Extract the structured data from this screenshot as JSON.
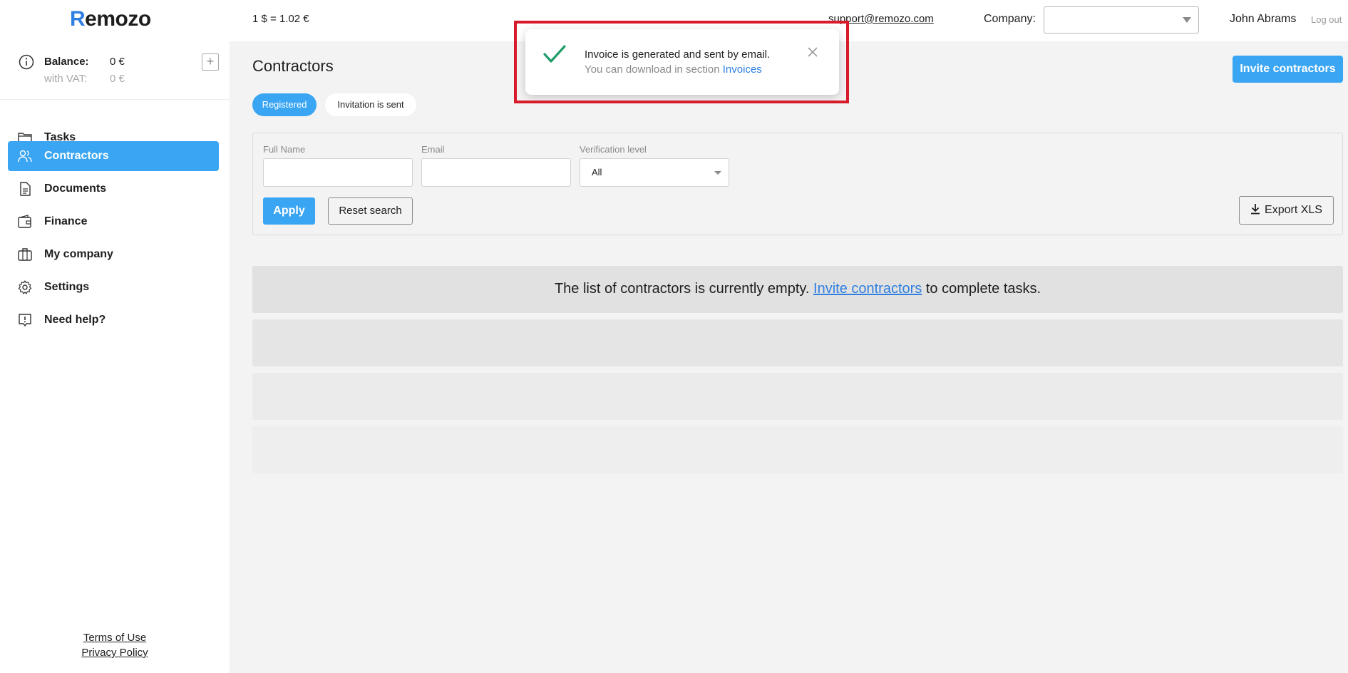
{
  "header": {
    "logo_first": "R",
    "logo_rest": "emozo",
    "exchange_rate": "1 $ = 1.02 €",
    "support_email": "support@remozo.com",
    "company_label": "Company:",
    "company_value": "",
    "user_name": "John Abrams",
    "logout_label": "Log out"
  },
  "sidebar": {
    "balance_label": "Balance:",
    "balance_value": "0 €",
    "vat_label": "with VAT:",
    "vat_value": "0 €",
    "add_label": "+",
    "items": [
      {
        "label": "Tasks",
        "icon": "folder-icon"
      },
      {
        "label": "Contractors",
        "icon": "users-icon",
        "active": true
      },
      {
        "label": "Documents",
        "icon": "document-icon"
      },
      {
        "label": "Finance",
        "icon": "wallet-icon"
      },
      {
        "label": "My company",
        "icon": "briefcase-icon"
      },
      {
        "label": "Settings",
        "icon": "gear-icon"
      },
      {
        "label": "Need help?",
        "icon": "help-icon"
      }
    ],
    "terms_label": "Terms of Use",
    "privacy_label": "Privacy Policy"
  },
  "main": {
    "title": "Contractors",
    "invite_button": "Invite contractors",
    "tabs": [
      {
        "label": "Registered",
        "active": true
      },
      {
        "label": "Invitation is sent",
        "active": false
      }
    ],
    "filters": {
      "full_name_label": "Full Name",
      "full_name_value": "",
      "email_label": "Email",
      "email_value": "",
      "verification_label": "Verification level",
      "verification_value": "All",
      "apply_button": "Apply",
      "reset_button": "Reset search",
      "export_button": "Export XLS"
    },
    "empty_message": {
      "before": "The list of contractors is currently empty. ",
      "link": "Invite contractors",
      "after": " to complete tasks."
    }
  },
  "toast": {
    "title": "Invoice is generated and sent by email.",
    "body": "You can download in section ",
    "link": "Invoices",
    "check_color": "#1f9d6a",
    "highlight_color": "#d81b2a"
  },
  "colors": {
    "accent": "#3aa5f3",
    "link": "#2f7fe0",
    "background": "#f3f3f3"
  }
}
